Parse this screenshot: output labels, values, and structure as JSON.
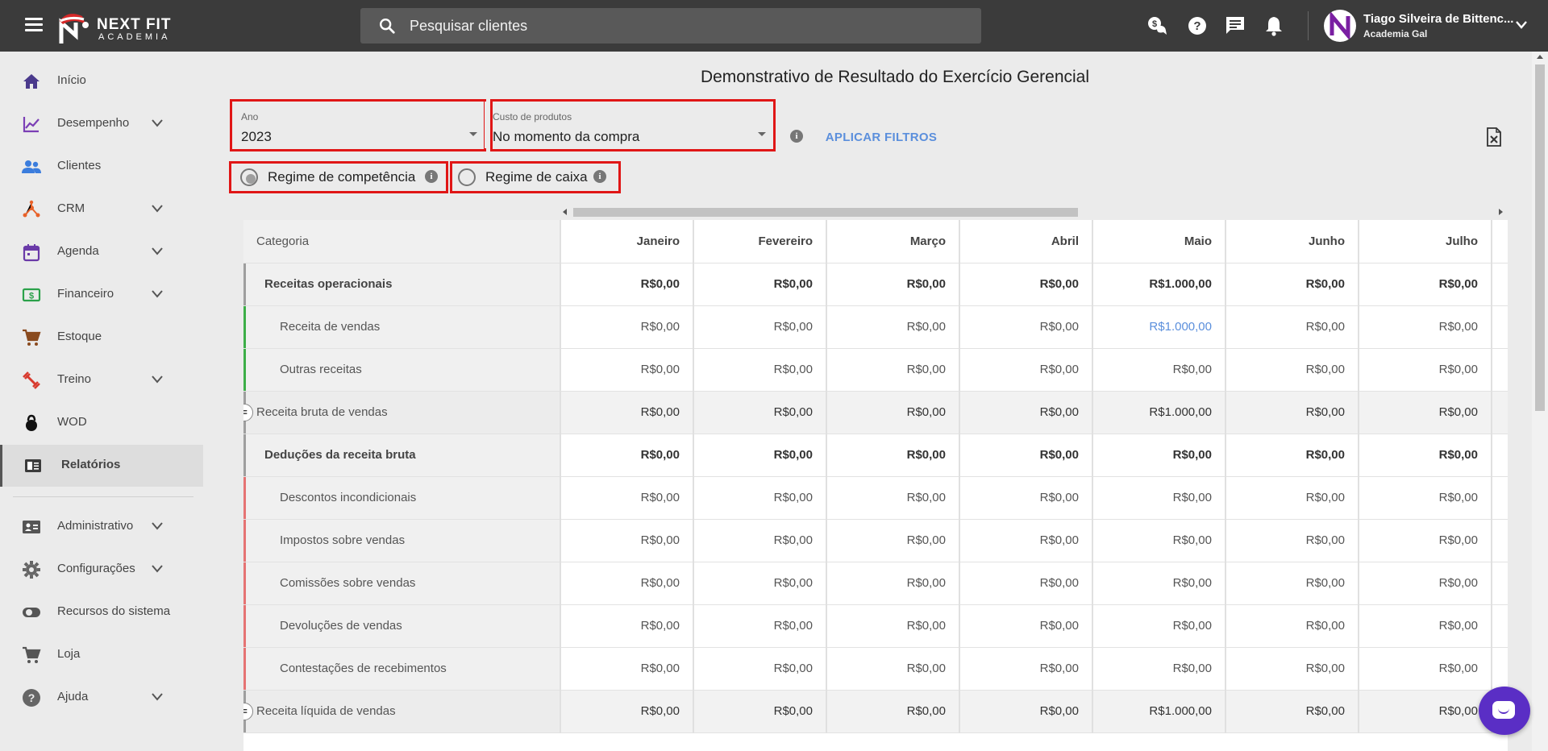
{
  "header": {
    "logo_line1": "NEXT FIT",
    "logo_line2": "ACADEMIA",
    "search_placeholder": "Pesquisar clientes",
    "user_name": "Tiago Silveira de Bittenc...",
    "user_org": "Academia Gal",
    "icons": [
      "money-chat-icon",
      "help-icon",
      "messages-icon",
      "notifications-icon"
    ]
  },
  "sidebar": {
    "items": [
      {
        "label": "Início",
        "icon": "home-icon"
      },
      {
        "label": "Desempenho",
        "icon": "chart-line-icon"
      },
      {
        "label": "Clientes",
        "icon": "people-icon"
      },
      {
        "label": "CRM",
        "icon": "hub-icon"
      },
      {
        "label": "Agenda",
        "icon": "calendar-icon"
      },
      {
        "label": "Financeiro",
        "icon": "money-icon"
      },
      {
        "label": "Estoque",
        "icon": "cart-icon"
      },
      {
        "label": "Treino",
        "icon": "dumbbell-icon"
      },
      {
        "label": "WOD",
        "icon": "kettlebell-icon"
      },
      {
        "label": "Relatórios",
        "icon": "reports-icon"
      },
      {
        "label": "Administrativo",
        "icon": "id-card-icon"
      },
      {
        "label": "Configurações",
        "icon": "gear-icon"
      },
      {
        "label": "Recursos do sistema",
        "icon": "toggle-icon"
      },
      {
        "label": "Loja",
        "icon": "cart-icon"
      },
      {
        "label": "Ajuda",
        "icon": "help-icon"
      }
    ]
  },
  "page": {
    "title": "Demonstrativo de Resultado do Exercício Gerencial",
    "filters": {
      "year_label": "Ano",
      "year_value": "2023",
      "cost_label": "Custo de produtos",
      "cost_value": "No momento da compra",
      "apply_label": "APLICAR FILTROS"
    },
    "regimes": [
      {
        "label": "Regime de competência",
        "selected": true
      },
      {
        "label": "Regime de caixa",
        "selected": false
      }
    ]
  },
  "table": {
    "header_category": "Categoria",
    "months": [
      "Janeiro",
      "Fevereiro",
      "Março",
      "Abril",
      "Maio",
      "Junho",
      "Julho"
    ],
    "rows": [
      {
        "label": "Receitas operacionais",
        "type": "group",
        "values": [
          "R$0,00",
          "R$0,00",
          "R$0,00",
          "R$0,00",
          "R$1.000,00",
          "R$0,00",
          "R$0,00"
        ]
      },
      {
        "label": "Receita de vendas",
        "type": "sub",
        "accent": "#3cae47",
        "values": [
          "R$0,00",
          "R$0,00",
          "R$0,00",
          "R$0,00",
          "R$1.000,00",
          "R$0,00",
          "R$0,00"
        ]
      },
      {
        "label": "Outras receitas",
        "type": "sub",
        "accent": "#3cae47",
        "values": [
          "R$0,00",
          "R$0,00",
          "R$0,00",
          "R$0,00",
          "R$0,00",
          "R$0,00",
          "R$0,00"
        ]
      },
      {
        "label": "Receita bruta de vendas",
        "type": "total",
        "values": [
          "R$0,00",
          "R$0,00",
          "R$0,00",
          "R$0,00",
          "R$1.000,00",
          "R$0,00",
          "R$0,00"
        ]
      },
      {
        "label": "Deduções da receita bruta",
        "type": "group",
        "values": [
          "R$0,00",
          "R$0,00",
          "R$0,00",
          "R$0,00",
          "R$0,00",
          "R$0,00",
          "R$0,00"
        ]
      },
      {
        "label": "Descontos incondicionais",
        "type": "sub",
        "accent": "#e57373",
        "values": [
          "R$0,00",
          "R$0,00",
          "R$0,00",
          "R$0,00",
          "R$0,00",
          "R$0,00",
          "R$0,00"
        ]
      },
      {
        "label": "Impostos sobre vendas",
        "type": "sub",
        "accent": "#e57373",
        "values": [
          "R$0,00",
          "R$0,00",
          "R$0,00",
          "R$0,00",
          "R$0,00",
          "R$0,00",
          "R$0,00"
        ]
      },
      {
        "label": "Comissões sobre vendas",
        "type": "sub",
        "accent": "#e57373",
        "values": [
          "R$0,00",
          "R$0,00",
          "R$0,00",
          "R$0,00",
          "R$0,00",
          "R$0,00",
          "R$0,00"
        ]
      },
      {
        "label": "Devoluções de vendas",
        "type": "sub",
        "accent": "#e57373",
        "values": [
          "R$0,00",
          "R$0,00",
          "R$0,00",
          "R$0,00",
          "R$0,00",
          "R$0,00",
          "R$0,00"
        ]
      },
      {
        "label": "Contestações de recebimentos",
        "type": "sub",
        "accent": "#e57373",
        "values": [
          "R$0,00",
          "R$0,00",
          "R$0,00",
          "R$0,00",
          "R$0,00",
          "R$0,00",
          "R$0,00"
        ]
      },
      {
        "label": "Receita líquida de vendas",
        "type": "total",
        "values": [
          "R$0,00",
          "R$0,00",
          "R$0,00",
          "R$0,00",
          "R$1.000,00",
          "R$0,00",
          "R$0,00"
        ]
      }
    ]
  },
  "colors": {
    "header_bg": "#3b3b3b",
    "link": "#5b8fdc",
    "highlight": "#e01616",
    "chat": "#5a2ec5"
  }
}
